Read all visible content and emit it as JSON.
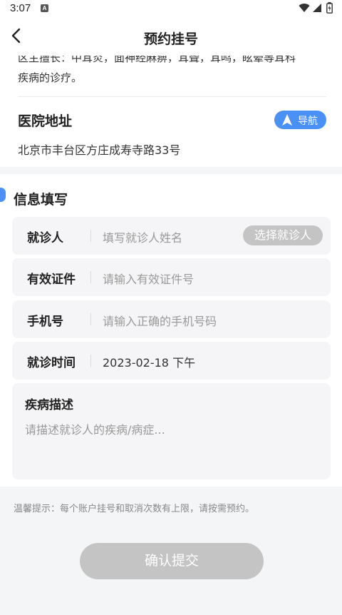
{
  "status_bar": {
    "time": "3:07",
    "notification_icon": "A"
  },
  "header": {
    "title": "预约挂号",
    "back_icon": "chevron-left-icon"
  },
  "intro": {
    "line1_partial": "区主擅长：中耳炎，面神经麻痹，耳聋，耳鸣，眩晕等耳科",
    "line2": "疾病的诊疗。"
  },
  "hospital_address": {
    "label": "医院地址",
    "nav_button": "导航",
    "value": "北京市丰台区方庄成寿寺路33号"
  },
  "form": {
    "section_title": "信息填写",
    "patient": {
      "label": "就诊人",
      "placeholder": "填写就诊人姓名",
      "select_button": "选择就诊人"
    },
    "id_card": {
      "label": "有效证件",
      "placeholder": "请输入有效证件号"
    },
    "phone": {
      "label": "手机号",
      "placeholder": "请输入正确的手机号码"
    },
    "visit_time": {
      "label": "就诊时间",
      "value": "2023-02-18 下午"
    },
    "description": {
      "label": "疾病描述",
      "placeholder": "请描述就诊人的疾病/病症..."
    }
  },
  "tip": "温馨提示：每个账户挂号和取消次数有上限，请按需预约。",
  "submit_button": "确认提交",
  "colors": {
    "accent": "#4a90f5",
    "disabled": "#c4c4c4",
    "background": "#f4f5f7"
  }
}
